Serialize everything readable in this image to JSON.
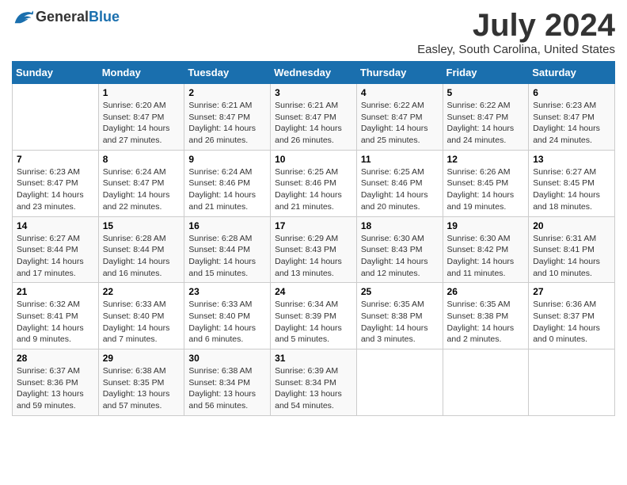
{
  "logo": {
    "general": "General",
    "blue": "Blue"
  },
  "header": {
    "title": "July 2024",
    "subtitle": "Easley, South Carolina, United States"
  },
  "weekdays": [
    "Sunday",
    "Monday",
    "Tuesday",
    "Wednesday",
    "Thursday",
    "Friday",
    "Saturday"
  ],
  "weeks": [
    [
      {
        "day": "",
        "info": ""
      },
      {
        "day": "1",
        "info": "Sunrise: 6:20 AM\nSunset: 8:47 PM\nDaylight: 14 hours\nand 27 minutes."
      },
      {
        "day": "2",
        "info": "Sunrise: 6:21 AM\nSunset: 8:47 PM\nDaylight: 14 hours\nand 26 minutes."
      },
      {
        "day": "3",
        "info": "Sunrise: 6:21 AM\nSunset: 8:47 PM\nDaylight: 14 hours\nand 26 minutes."
      },
      {
        "day": "4",
        "info": "Sunrise: 6:22 AM\nSunset: 8:47 PM\nDaylight: 14 hours\nand 25 minutes."
      },
      {
        "day": "5",
        "info": "Sunrise: 6:22 AM\nSunset: 8:47 PM\nDaylight: 14 hours\nand 24 minutes."
      },
      {
        "day": "6",
        "info": "Sunrise: 6:23 AM\nSunset: 8:47 PM\nDaylight: 14 hours\nand 24 minutes."
      }
    ],
    [
      {
        "day": "7",
        "info": "Sunrise: 6:23 AM\nSunset: 8:47 PM\nDaylight: 14 hours\nand 23 minutes."
      },
      {
        "day": "8",
        "info": "Sunrise: 6:24 AM\nSunset: 8:47 PM\nDaylight: 14 hours\nand 22 minutes."
      },
      {
        "day": "9",
        "info": "Sunrise: 6:24 AM\nSunset: 8:46 PM\nDaylight: 14 hours\nand 21 minutes."
      },
      {
        "day": "10",
        "info": "Sunrise: 6:25 AM\nSunset: 8:46 PM\nDaylight: 14 hours\nand 21 minutes."
      },
      {
        "day": "11",
        "info": "Sunrise: 6:25 AM\nSunset: 8:46 PM\nDaylight: 14 hours\nand 20 minutes."
      },
      {
        "day": "12",
        "info": "Sunrise: 6:26 AM\nSunset: 8:45 PM\nDaylight: 14 hours\nand 19 minutes."
      },
      {
        "day": "13",
        "info": "Sunrise: 6:27 AM\nSunset: 8:45 PM\nDaylight: 14 hours\nand 18 minutes."
      }
    ],
    [
      {
        "day": "14",
        "info": "Sunrise: 6:27 AM\nSunset: 8:44 PM\nDaylight: 14 hours\nand 17 minutes."
      },
      {
        "day": "15",
        "info": "Sunrise: 6:28 AM\nSunset: 8:44 PM\nDaylight: 14 hours\nand 16 minutes."
      },
      {
        "day": "16",
        "info": "Sunrise: 6:28 AM\nSunset: 8:44 PM\nDaylight: 14 hours\nand 15 minutes."
      },
      {
        "day": "17",
        "info": "Sunrise: 6:29 AM\nSunset: 8:43 PM\nDaylight: 14 hours\nand 13 minutes."
      },
      {
        "day": "18",
        "info": "Sunrise: 6:30 AM\nSunset: 8:43 PM\nDaylight: 14 hours\nand 12 minutes."
      },
      {
        "day": "19",
        "info": "Sunrise: 6:30 AM\nSunset: 8:42 PM\nDaylight: 14 hours\nand 11 minutes."
      },
      {
        "day": "20",
        "info": "Sunrise: 6:31 AM\nSunset: 8:41 PM\nDaylight: 14 hours\nand 10 minutes."
      }
    ],
    [
      {
        "day": "21",
        "info": "Sunrise: 6:32 AM\nSunset: 8:41 PM\nDaylight: 14 hours\nand 9 minutes."
      },
      {
        "day": "22",
        "info": "Sunrise: 6:33 AM\nSunset: 8:40 PM\nDaylight: 14 hours\nand 7 minutes."
      },
      {
        "day": "23",
        "info": "Sunrise: 6:33 AM\nSunset: 8:40 PM\nDaylight: 14 hours\nand 6 minutes."
      },
      {
        "day": "24",
        "info": "Sunrise: 6:34 AM\nSunset: 8:39 PM\nDaylight: 14 hours\nand 5 minutes."
      },
      {
        "day": "25",
        "info": "Sunrise: 6:35 AM\nSunset: 8:38 PM\nDaylight: 14 hours\nand 3 minutes."
      },
      {
        "day": "26",
        "info": "Sunrise: 6:35 AM\nSunset: 8:38 PM\nDaylight: 14 hours\nand 2 minutes."
      },
      {
        "day": "27",
        "info": "Sunrise: 6:36 AM\nSunset: 8:37 PM\nDaylight: 14 hours\nand 0 minutes."
      }
    ],
    [
      {
        "day": "28",
        "info": "Sunrise: 6:37 AM\nSunset: 8:36 PM\nDaylight: 13 hours\nand 59 minutes."
      },
      {
        "day": "29",
        "info": "Sunrise: 6:38 AM\nSunset: 8:35 PM\nDaylight: 13 hours\nand 57 minutes."
      },
      {
        "day": "30",
        "info": "Sunrise: 6:38 AM\nSunset: 8:34 PM\nDaylight: 13 hours\nand 56 minutes."
      },
      {
        "day": "31",
        "info": "Sunrise: 6:39 AM\nSunset: 8:34 PM\nDaylight: 13 hours\nand 54 minutes."
      },
      {
        "day": "",
        "info": ""
      },
      {
        "day": "",
        "info": ""
      },
      {
        "day": "",
        "info": ""
      }
    ]
  ]
}
